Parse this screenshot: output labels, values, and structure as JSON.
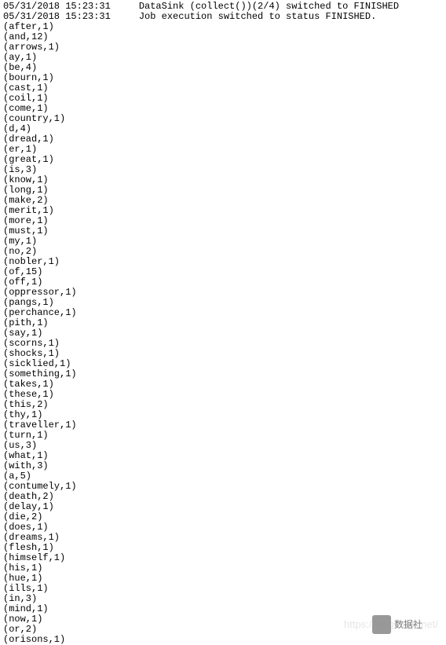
{
  "log": [
    {
      "timestamp": "05/31/2018 15:23:31",
      "message": "DataSink (collect())(2/4) switched to FINISHED"
    },
    {
      "timestamp": "05/31/2018 15:23:31",
      "message": "Job execution switched to status FINISHED."
    }
  ],
  "wordcounts": [
    {
      "word": "after",
      "count": 1
    },
    {
      "word": "and",
      "count": 12
    },
    {
      "word": "arrows",
      "count": 1
    },
    {
      "word": "ay",
      "count": 1
    },
    {
      "word": "be",
      "count": 4
    },
    {
      "word": "bourn",
      "count": 1
    },
    {
      "word": "cast",
      "count": 1
    },
    {
      "word": "coil",
      "count": 1
    },
    {
      "word": "come",
      "count": 1
    },
    {
      "word": "country",
      "count": 1
    },
    {
      "word": "d",
      "count": 4
    },
    {
      "word": "dread",
      "count": 1
    },
    {
      "word": "er",
      "count": 1
    },
    {
      "word": "great",
      "count": 1
    },
    {
      "word": "is",
      "count": 3
    },
    {
      "word": "know",
      "count": 1
    },
    {
      "word": "long",
      "count": 1
    },
    {
      "word": "make",
      "count": 2
    },
    {
      "word": "merit",
      "count": 1
    },
    {
      "word": "more",
      "count": 1
    },
    {
      "word": "must",
      "count": 1
    },
    {
      "word": "my",
      "count": 1
    },
    {
      "word": "no",
      "count": 2
    },
    {
      "word": "nobler",
      "count": 1
    },
    {
      "word": "of",
      "count": 15
    },
    {
      "word": "off",
      "count": 1
    },
    {
      "word": "oppressor",
      "count": 1
    },
    {
      "word": "pangs",
      "count": 1
    },
    {
      "word": "perchance",
      "count": 1
    },
    {
      "word": "pith",
      "count": 1
    },
    {
      "word": "say",
      "count": 1
    },
    {
      "word": "scorns",
      "count": 1
    },
    {
      "word": "shocks",
      "count": 1
    },
    {
      "word": "sicklied",
      "count": 1
    },
    {
      "word": "something",
      "count": 1
    },
    {
      "word": "takes",
      "count": 1
    },
    {
      "word": "these",
      "count": 1
    },
    {
      "word": "this",
      "count": 2
    },
    {
      "word": "thy",
      "count": 1
    },
    {
      "word": "traveller",
      "count": 1
    },
    {
      "word": "turn",
      "count": 1
    },
    {
      "word": "us",
      "count": 3
    },
    {
      "word": "what",
      "count": 1
    },
    {
      "word": "with",
      "count": 3
    },
    {
      "word": "a",
      "count": 5
    },
    {
      "word": "contumely",
      "count": 1
    },
    {
      "word": "death",
      "count": 2
    },
    {
      "word": "delay",
      "count": 1
    },
    {
      "word": "die",
      "count": 2
    },
    {
      "word": "does",
      "count": 1
    },
    {
      "word": "dreams",
      "count": 1
    },
    {
      "word": "flesh",
      "count": 1
    },
    {
      "word": "himself",
      "count": 1
    },
    {
      "word": "his",
      "count": 1
    },
    {
      "word": "hue",
      "count": 1
    },
    {
      "word": "ills",
      "count": 1
    },
    {
      "word": "in",
      "count": 3
    },
    {
      "word": "mind",
      "count": 1
    },
    {
      "word": "now",
      "count": 1
    },
    {
      "word": "or",
      "count": 2
    },
    {
      "word": "orisons",
      "count": 1
    }
  ],
  "watermark": {
    "text": "https://blog.csdn.net/",
    "badge": "数据社"
  }
}
